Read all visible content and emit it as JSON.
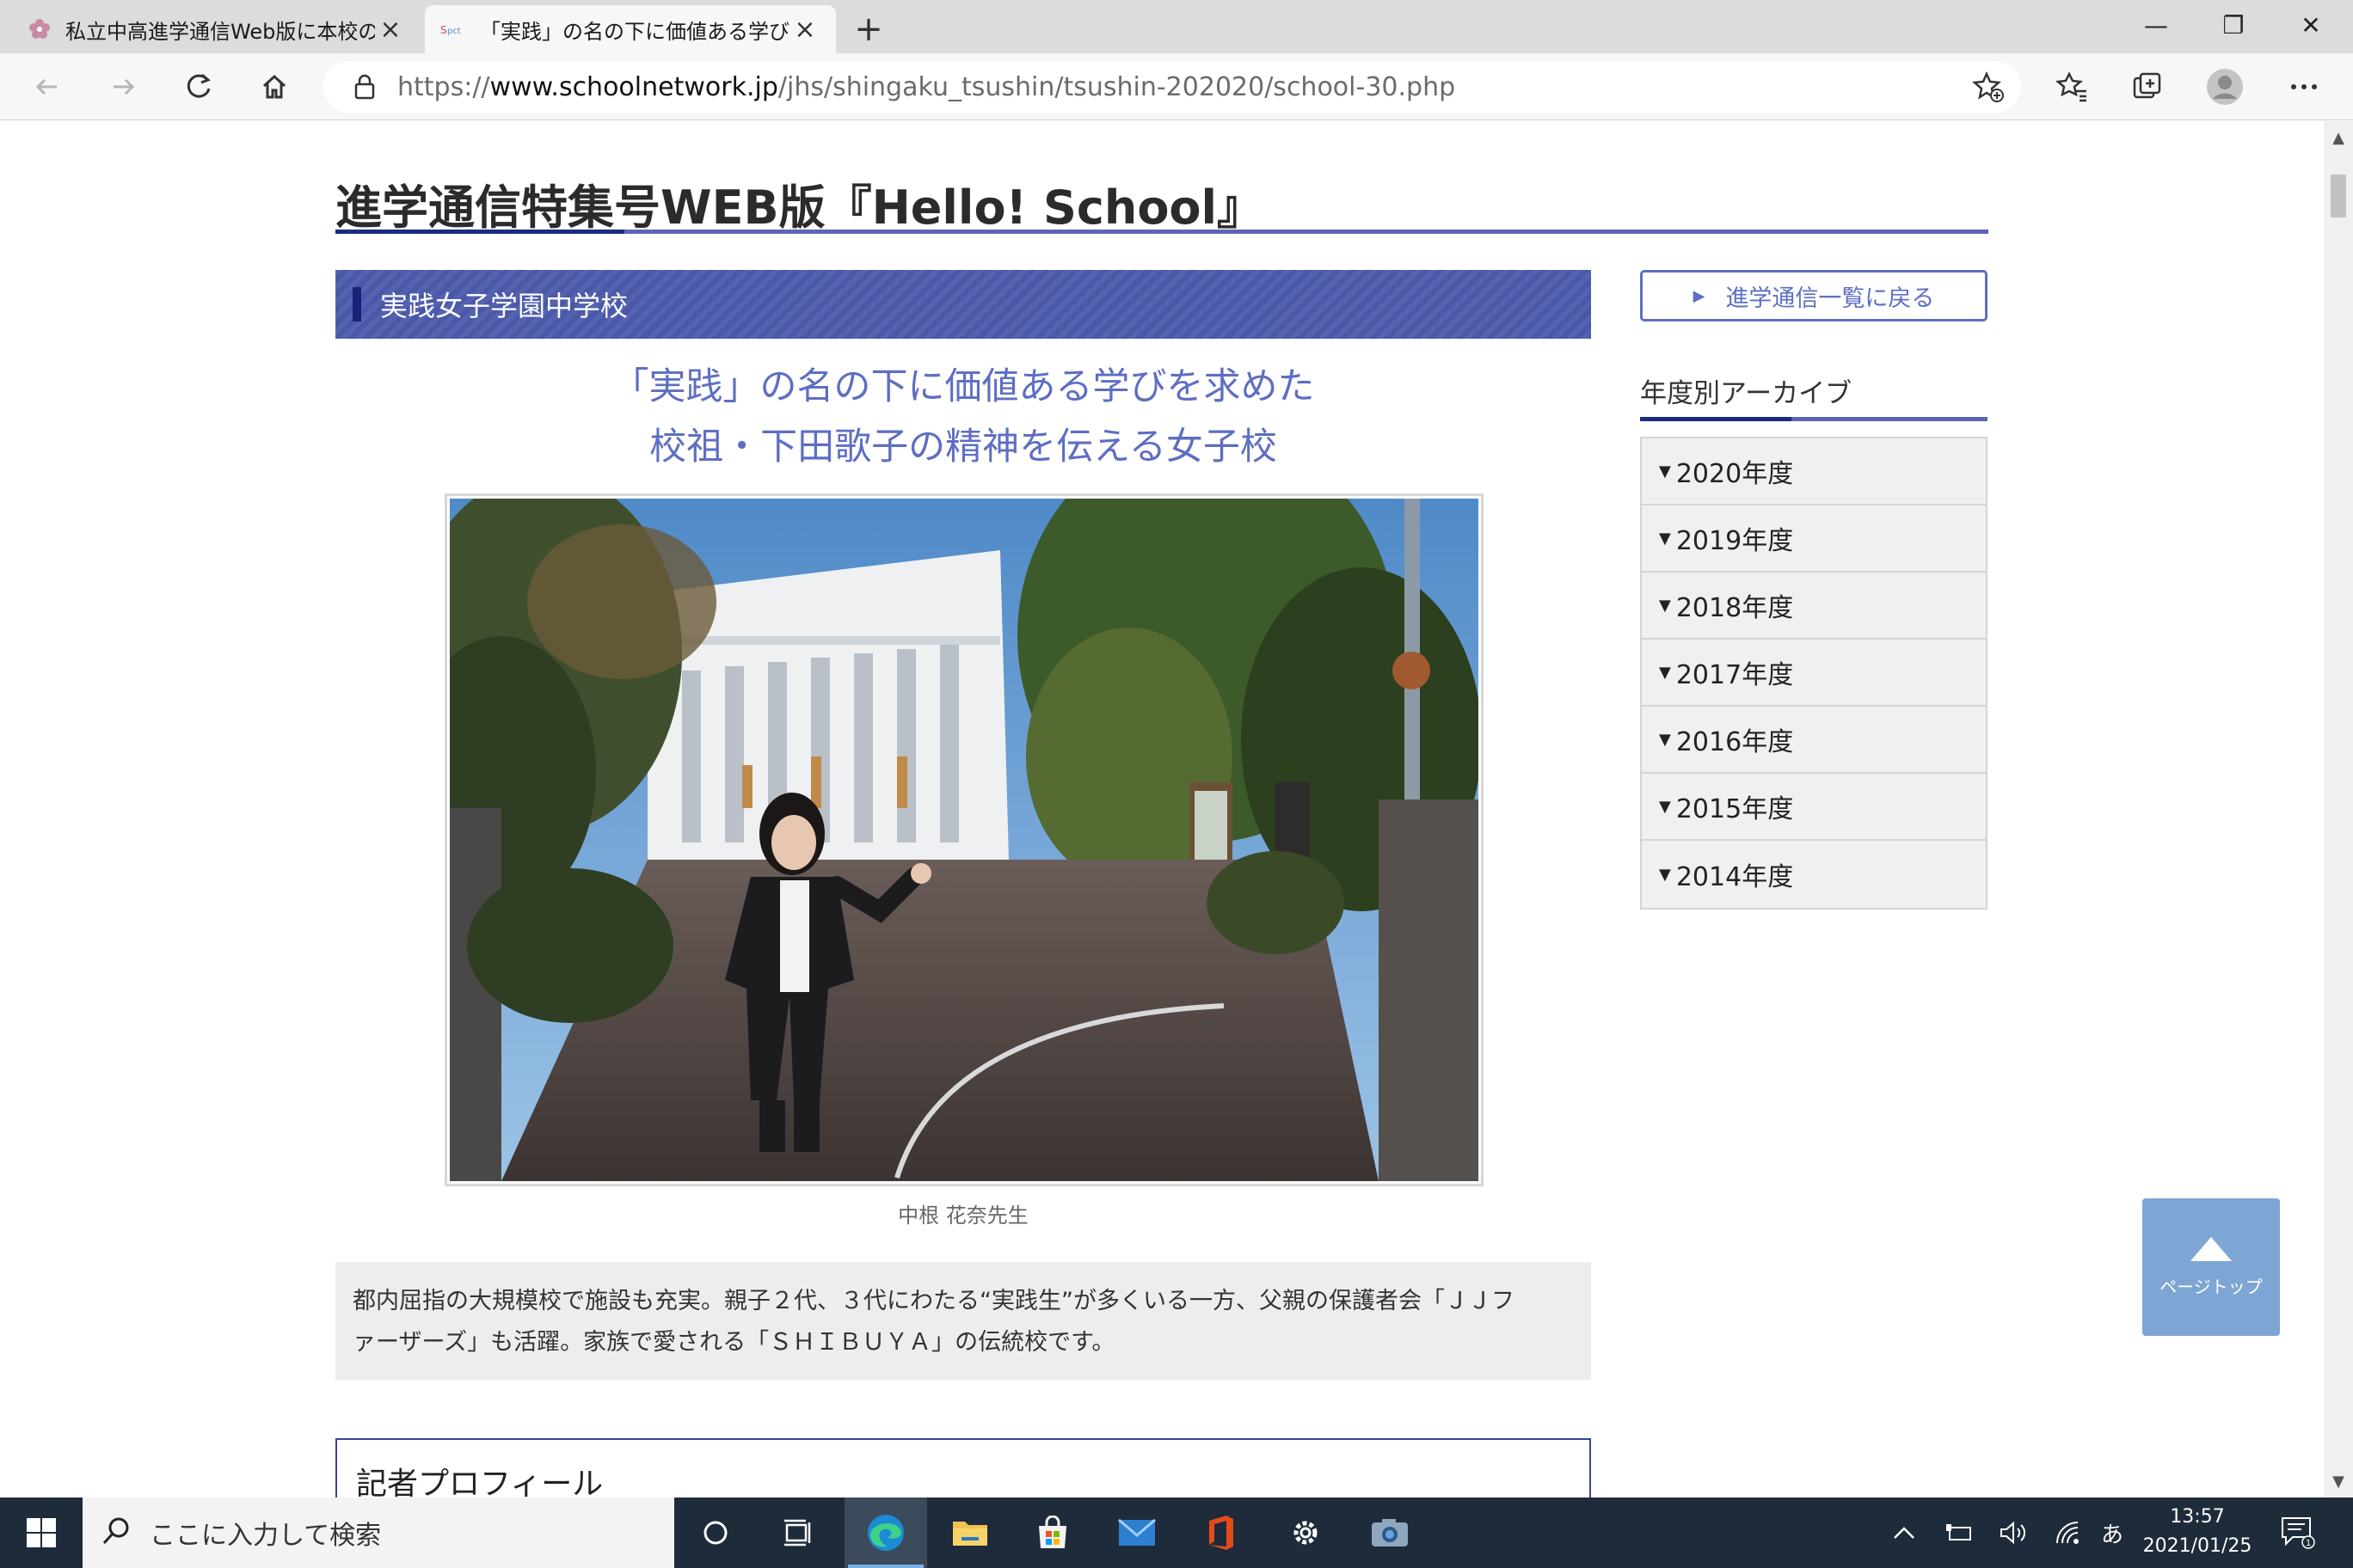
{
  "browser": {
    "tabs": [
      {
        "title": "私立中高進学通信Web版に本校の",
        "active": false
      },
      {
        "title": "「実践」の名の下に価値ある学びを求",
        "active": true
      }
    ],
    "url_prefix": "https://",
    "url_host": "www.schoolnetwork.jp",
    "url_path": "/jhs/shingaku_tsushin/tsushin-202020/school-30.php",
    "window_controls": {
      "minimize": "—",
      "restore": "❐",
      "close": "✕"
    }
  },
  "page": {
    "title": "進学通信特集号WEB版『Hello! School』",
    "school_name": "実践女子学園中学校",
    "headline_line1": "「実践」の名の下に価値ある学びを求めた",
    "headline_line2": "校祖・下田歌子の精神を伝える女子校",
    "photo_caption": "中根 花奈先生",
    "intro_line1": "都内屈指の大規模校で施設も充実。親子２代、３代にわたる“実践生”が多くいる一方、父親の保護者会「ＪＪフ",
    "intro_line2": "ァーザーズ」も活躍。家族で愛される「ＳＨＩＢＵＹＡ」の伝統校です。",
    "profile_title": "記者プロフィール"
  },
  "sidebar": {
    "back_button": "進学通信一覧に戻る",
    "archive_title": "年度別アーカイブ",
    "archive_years": [
      "2020年度",
      "2019年度",
      "2018年度",
      "2017年度",
      "2016年度",
      "2015年度",
      "2014年度"
    ]
  },
  "page_top_button": "ページトップ",
  "taskbar": {
    "search_placeholder": "ここに入力して検索",
    "ime": "あ",
    "time": "13:57",
    "date": "2021/01/25",
    "notification_count": "1"
  },
  "colors": {
    "accent": "#5e6ec2",
    "accent_dark": "#1c2a80",
    "school_bar": "#5463b0",
    "page_top": "#7ea6d4",
    "taskbar": "#1e2b3a"
  }
}
